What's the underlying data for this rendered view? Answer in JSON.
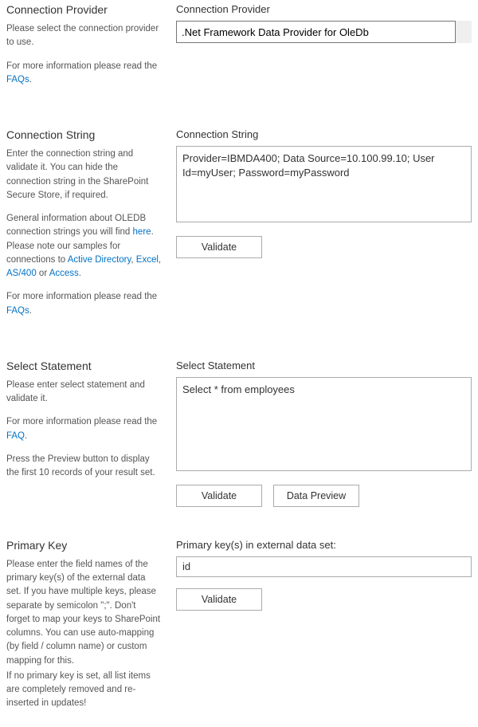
{
  "sections": {
    "provider": {
      "heading": "Connection Provider",
      "desc": "Please select the connection provider to use.",
      "info_prefix": "For more information please read the ",
      "info_link": "FAQs",
      "info_suffix": ".",
      "label": "Connection Provider",
      "selected": ".Net Framework Data Provider for OleDb"
    },
    "conn_string": {
      "heading": "Connection String",
      "desc": "Enter the connection string and validate it. You can hide the connection string in the SharePoint Secure Store, if required.",
      "note_prefix": "General information about OLEDB connection strings you will find ",
      "note_link_here": "here",
      "note_mid": ". Please note our samples for connections to ",
      "link_ad": "Active Directory",
      "link_excel": "Excel",
      "link_as400": "AS/400",
      "link_access": "Access",
      "note_suffix": ".",
      "info_prefix": "For more information please read the ",
      "info_link": "FAQs",
      "info_suffix": ".",
      "label": "Connection String",
      "value": "Provider=IBMDA400; Data Source=10.100.99.10; User Id=myUser; Password=myPassword",
      "validate_btn": "Validate"
    },
    "select_stmt": {
      "heading": "Select Statement",
      "desc": "Please enter select statement and validate it.",
      "info_prefix": "For more information please read the ",
      "info_link": "FAQ",
      "info_suffix": ".",
      "press_note": "Press the Preview button to display the first 10 records of your result set.",
      "label": "Select Statement",
      "value": "Select * from employees",
      "validate_btn": "Validate",
      "preview_btn": "Data Preview"
    },
    "primary_key": {
      "heading": "Primary Key",
      "desc": "Please enter the field names of the primary key(s) of the external data set. If you have multiple keys, please separate by semicolon \";\". Don't forget to map your keys to SharePoint columns. You can use auto-mapping (by field / column name) or custom mapping for this.",
      "note2": "If no primary key is set, all list items are completely removed and re-inserted in updates!",
      "label": "Primary key(s) in external data set:",
      "value": "id",
      "validate_btn": "Validate"
    }
  }
}
